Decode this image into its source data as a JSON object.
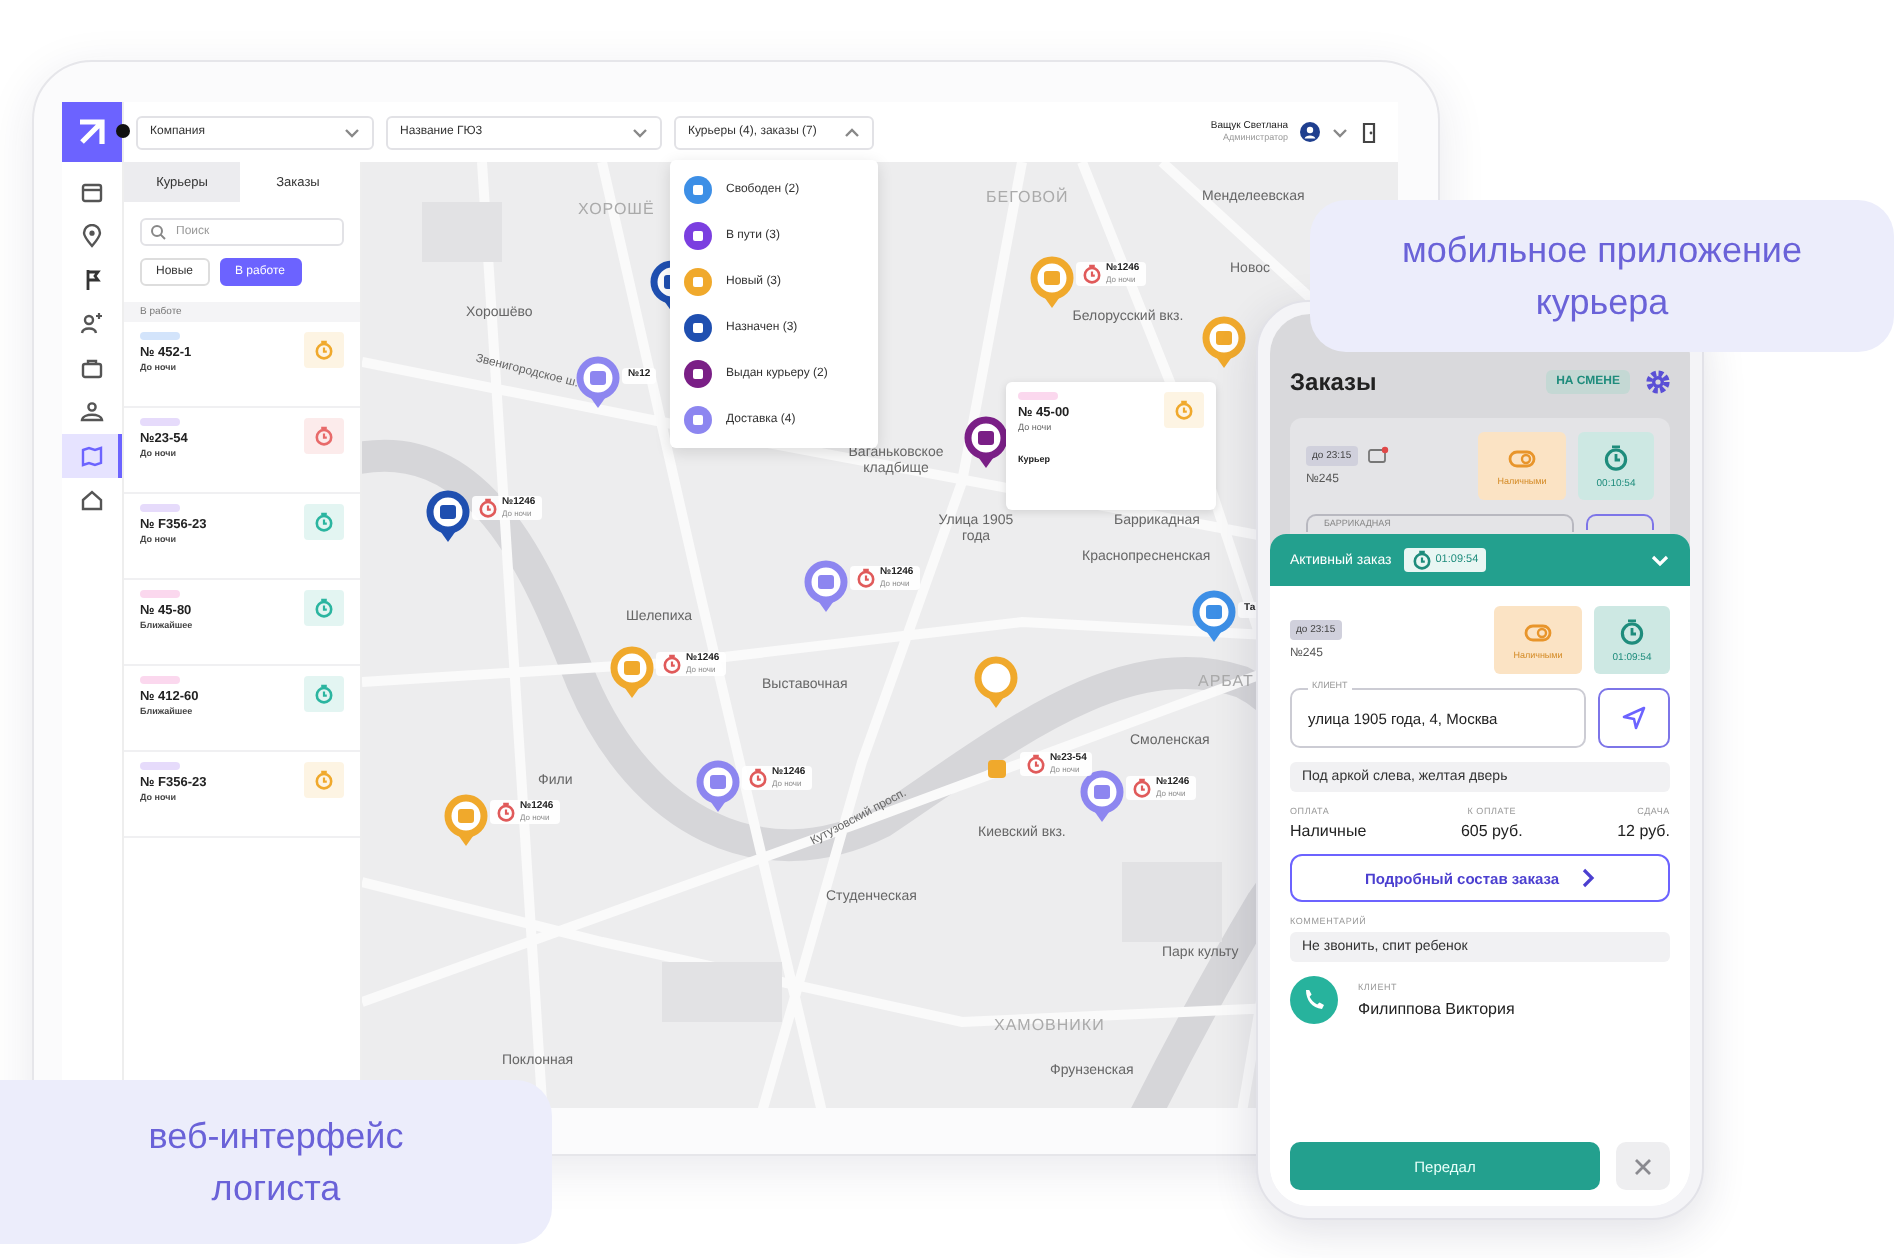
{
  "web_app": {
    "rail": [
      {
        "selected": false
      },
      {
        "selected": false
      },
      {
        "selected": false
      },
      {
        "selected": false
      },
      {
        "selected": false
      },
      {
        "selected": false
      },
      {
        "selected": true
      },
      {
        "selected": false
      }
    ],
    "company_select": {
      "value": "Компания"
    },
    "branch_select": {
      "value": "Название ГЮ3"
    },
    "filter_select": {
      "value": "Курьеры (4), заказы (7)",
      "expanded": true
    },
    "user": {
      "name": "Ващук Светлана",
      "role": "Администратор"
    },
    "sidebar": {
      "tabs": [
        {
          "label": "Курьеры",
          "selected": true
        },
        {
          "label": "Заказы",
          "selected": false
        }
      ],
      "search": {
        "placeholder": "Поиск"
      },
      "filters": [
        {
          "label": "Новые",
          "selected": false
        },
        {
          "label": "В работе",
          "selected": true
        }
      ],
      "section": "В работе",
      "orders": [
        {
          "tag": {
            "color": "#d3e4fb"
          },
          "number": "№ 452-1",
          "slot": "До ночи",
          "timer": {
            "color": "#f0a92c"
          }
        },
        {
          "tag": {
            "color": "#e6dbfb"
          },
          "number": "№23-54",
          "slot": "До ночи",
          "timer": {
            "color": "#e86a6a"
          }
        },
        {
          "tag": {
            "color": "#e6dbfb"
          },
          "number": "№ F356-23",
          "slot": "До ночи",
          "timer": {
            "color": "#2bb5a0"
          }
        },
        {
          "tag": {
            "color": "#fbd8ee"
          },
          "number": "№ 45-80",
          "slot": "Ближайшее",
          "timer": {
            "color": "#2bb5a0"
          }
        },
        {
          "tag": {
            "color": "#fbd8ee"
          },
          "number": "№ 412-60",
          "slot": "Ближайшее",
          "timer": {
            "color": "#2bb5a0"
          }
        },
        {
          "tag": {
            "color": "#e6dbfb"
          },
          "number": "№ F356-23",
          "slot": "До ночи",
          "timer": {
            "color": "#f0a92c"
          }
        }
      ]
    },
    "status_menu": [
      {
        "label": "Свободен (2)",
        "color": "#3d8fe6"
      },
      {
        "label": "В пути (3)",
        "color": "#7b3fe0"
      },
      {
        "label": "Новый (3)",
        "color": "#f0a92c"
      },
      {
        "label": "Назначен (3)",
        "color": "#1f4fb0"
      },
      {
        "label": "Выдан курьеру (2)",
        "color": "#7a1f86"
      },
      {
        "label": "Доставка (4)",
        "color": "#8d86f0"
      }
    ],
    "map": {
      "labels": [
        "ХОРОШЁ",
        "Хорошёво",
        "БЕГОВОЙ",
        "Менделеевская",
        "Новос",
        "Белорусский вкз.",
        "Ваганьковское кладбище",
        "Улица 1905 года",
        "Баррикадная",
        "Краснопресненская",
        "Шелепиха",
        "Выставочная",
        "АРБАТ",
        "Смоленская",
        "Фили",
        "Киевский вкз.",
        "Студенческая",
        "Парк культу",
        "ХАМОВНИКИ",
        "Поклонная",
        "Фрунзенская",
        "Звенигородское ш.",
        "Кутузовский просп."
      ],
      "pins": [
        {
          "kind": "pin",
          "color": "#1f4fb0"
        },
        {
          "kind": "pin",
          "color": "#8d86f0",
          "number": "№12"
        },
        {
          "kind": "pin",
          "color": "#1f4fb0",
          "number": "№1246",
          "slot": "До ночи"
        },
        {
          "kind": "pin",
          "color": "#f0a92c",
          "number": "№1246",
          "slot": "До ночи"
        },
        {
          "kind": "pin",
          "color": "#f0a92c"
        },
        {
          "kind": "pin",
          "color": "#7a1f86"
        },
        {
          "kind": "pin",
          "color": "#8d86f0",
          "number": "№1246",
          "slot": "До ночи"
        },
        {
          "kind": "pin",
          "color": "#3d8fe6",
          "number": "Та"
        },
        {
          "kind": "pin",
          "color": "#f0a92c",
          "number": "№1246",
          "slot": "До ночи"
        },
        {
          "kind": "ring",
          "color": "#f0a92c"
        },
        {
          "kind": "pin",
          "color": "#8d86f0",
          "number": "№1246",
          "slot": "До ночи"
        },
        {
          "kind": "pin",
          "color": "#8d86f0",
          "number": "№1246",
          "slot": "До ночи"
        },
        {
          "kind": "pin",
          "color": "#f0a92c",
          "number": "№1246",
          "slot": "До ночи"
        },
        {
          "kind": "dot",
          "color": "#f0a92c",
          "number": "№23-54",
          "slot": "До ночи"
        }
      ],
      "popup": {
        "number": "№ 45-00",
        "slot": "До ночи",
        "courier": "Курьер"
      }
    }
  },
  "mobile_app": {
    "title": "Заказы",
    "shift_badge": "НА СМЕНЕ",
    "background_order": {
      "deadline": "до 23:15",
      "number": "№245",
      "payment": "Наличными",
      "timer": "00:10:54",
      "field_label": "БАРРИКАДНАЯ"
    },
    "active_order": {
      "title": "Активный заказ",
      "elapsed": "01:09:54",
      "expanded": true,
      "deadline": "до 23:15",
      "number": "№245",
      "payment": "Наличными",
      "timer": "01:09:54",
      "address_label": "КЛИЕНТ",
      "address": "улица 1905 года, 4, Москва",
      "note": "Под аркой слева, желтая дверь",
      "payment_info": [
        {
          "label": "ОПЛАТА",
          "value": "Наличные"
        },
        {
          "label": "К ОПЛАТЕ",
          "value": "605 руб."
        },
        {
          "label": "СДАЧА",
          "value": "12 руб."
        }
      ],
      "details_button": "Подробный состав заказа",
      "comment_label": "КОММЕНТАРИЙ",
      "comment": "Не звонить, спит ребенок",
      "client_label": "КЛИЕНТ",
      "client": "Филиппова Виктория",
      "primary_button": "Передал"
    }
  },
  "captions": [
    "мобильное приложение курьера",
    "веб-интерфейс логиста"
  ]
}
